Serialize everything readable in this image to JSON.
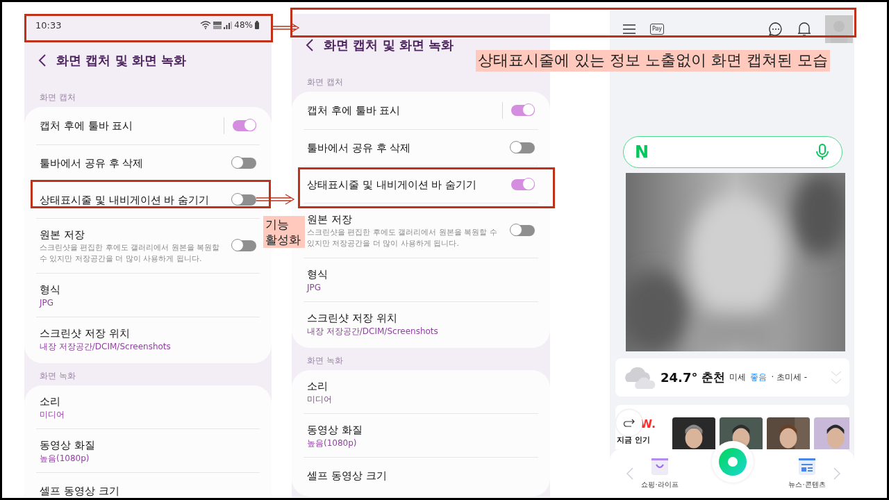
{
  "panels": [
    {
      "kind": "settings",
      "status_bar": {
        "time": "10:33",
        "battery": "48%"
      },
      "title": "화면 캡처 및 화면 녹화",
      "sections": [
        {
          "title": "화면 캡처",
          "items": [
            {
              "kind": "switch",
              "label": "캡처 후에 툴바 표시",
              "on": true,
              "separator": true
            },
            {
              "kind": "switch",
              "label": "툴바에서 공유 후 삭제",
              "on": false,
              "separator": false
            },
            {
              "kind": "switch",
              "label": "상태표시줄 및 내비게이션 바 숨기기",
              "on": false,
              "separator": false
            },
            {
              "kind": "switch",
              "label": "원본 저장",
              "description": "스크린샷을 편집한 후에도 갤러리에서 원본을 복원할 수 있지만 저장공간을 더 많이 사용하게 됩니다.",
              "on": false,
              "separator": false
            },
            {
              "kind": "value",
              "label": "형식",
              "value": "JPG"
            },
            {
              "kind": "value",
              "label": "스크린샷 저장 위치",
              "value": "내장 저장공간/DCIM/Screenshots"
            }
          ]
        },
        {
          "title": "화면 녹화",
          "items": [
            {
              "kind": "value",
              "label": "소리",
              "value": "미디어"
            },
            {
              "kind": "value",
              "label": "동영상 화질",
              "value": "높음(1080p)"
            },
            {
              "kind": "plain",
              "label": "셀프 동영상 크기"
            }
          ]
        }
      ]
    },
    {
      "kind": "settings",
      "title": "화면 캡처 및 화면 녹화",
      "sections": [
        {
          "title": "화면 캡처",
          "items": [
            {
              "kind": "switch",
              "label": "캡처 후에 툴바 표시",
              "on": true,
              "separator": true
            },
            {
              "kind": "switch",
              "label": "툴바에서 공유 후 삭제",
              "on": false,
              "separator": false
            },
            {
              "kind": "switch",
              "label": "상태표시줄 및 내비게이션 바 숨기기",
              "on": true,
              "separator": false
            },
            {
              "kind": "switch",
              "label": "원본 저장",
              "description": "스크린샷을 편집한 후에도 갤러리에서 원본을 복원할 수 있지만 저장공간을 더 많이 사용하게 됩니다.",
              "on": false,
              "separator": false
            },
            {
              "kind": "value",
              "label": "형식",
              "value": "JPG"
            },
            {
              "kind": "value",
              "label": "스크린샷 저장 위치",
              "value": "내장 저장공간/DCIM/Screenshots"
            }
          ]
        },
        {
          "title": "화면 녹화",
          "items": [
            {
              "kind": "value",
              "label": "소리",
              "value": "미디어"
            },
            {
              "kind": "value",
              "label": "동영상 화질",
              "value": "높음(1080p)"
            },
            {
              "kind": "plain",
              "label": "셀프 동영상 크기"
            }
          ]
        }
      ]
    },
    {
      "kind": "browser",
      "top_bar": {
        "pay_label": "Pay"
      },
      "search": {
        "logo": "N"
      },
      "feature": {
        "kind": "picture"
      },
      "weather": {
        "temperature": "24.7°",
        "city": "춘천",
        "fine_dust_label": "미세",
        "fine_dust_value": "좋음",
        "ultrafine": "· 초미세 -"
      },
      "now": {
        "logo": "W.",
        "title": "지금 인기",
        "thumbnails": [
          {
            "kind": "picture"
          },
          {
            "kind": "picture"
          },
          {
            "kind": "picture"
          },
          {
            "kind": "picture"
          }
        ]
      },
      "nav": [
        {
          "kind": "shopping",
          "label": "쇼핑·라이프"
        },
        {
          "kind": "news",
          "label": "뉴스·콘텐츠"
        }
      ]
    }
  ],
  "callouts": [
    {
      "text": "기능 활성화"
    },
    {
      "text": "상태표시줄에 있는 정보 노출없이 화면 캡쳐된 모습"
    }
  ]
}
